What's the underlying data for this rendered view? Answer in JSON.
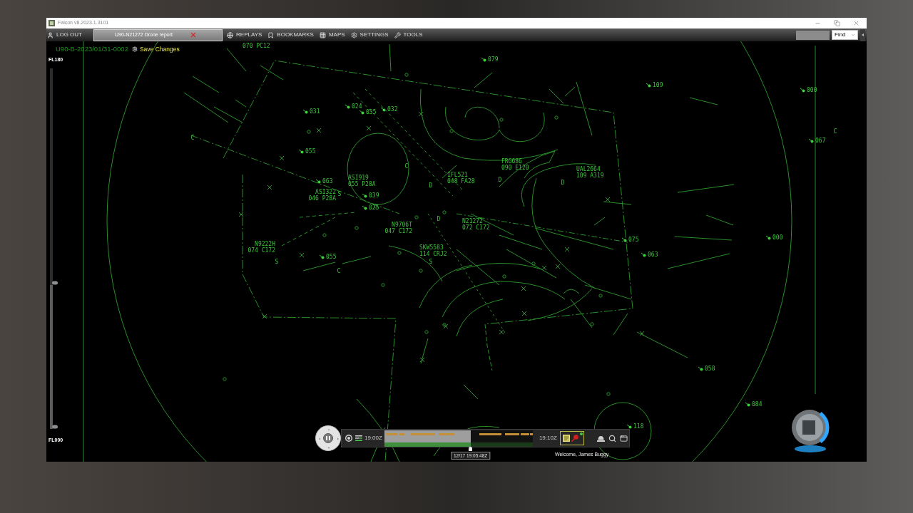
{
  "window": {
    "title": "Falcon v8.2023.1.3101"
  },
  "menu_bar": {
    "logout": "LOG OUT",
    "tabs": [
      {
        "label": "U90-N21272 Drone report",
        "selected": true
      }
    ],
    "items": [
      "REPLAYS",
      "BOOKMARKS",
      "MAPS",
      "SETTINGS",
      "TOOLS"
    ],
    "find_button": "Find"
  },
  "radar": {
    "session_id": "U90-B-2023/01/31-0002",
    "save_button": "Save Changes",
    "altitude_filter": {
      "top_label": "FL180",
      "bottom_label": "FL000",
      "thumbs": [
        {
          "level": 0.4
        },
        {
          "level": 0
        }
      ]
    },
    "targets": [
      {
        "kind": "full",
        "data": "070 PC12"
      },
      {
        "kind": "limited",
        "data": "079"
      },
      {
        "kind": "limited",
        "data": "109"
      },
      {
        "kind": "limited",
        "data": "000"
      },
      {
        "kind": "limited",
        "data": "031"
      },
      {
        "kind": "limited",
        "data": "024"
      },
      {
        "kind": "limited",
        "data": "035"
      },
      {
        "kind": "limited",
        "data": "032"
      },
      {
        "kind": "limited",
        "data": "067"
      },
      {
        "kind": "limited",
        "data": "055"
      },
      {
        "kind": "full",
        "callsign": "FRG686",
        "data": "090 E120"
      },
      {
        "kind": "limited",
        "data": "063"
      },
      {
        "kind": "full",
        "callsign": "ASI919",
        "data": "055 P28A"
      },
      {
        "kind": "full",
        "callsign": "IFL521",
        "data": "048 FA28"
      },
      {
        "kind": "full",
        "callsign": "UAL2664",
        "data": "109 A319"
      },
      {
        "kind": "full",
        "callsign": "ASI322",
        "data": "046 P28A"
      },
      {
        "kind": "limited",
        "data": "039"
      },
      {
        "kind": "limited",
        "data": "025"
      },
      {
        "kind": "full",
        "callsign": "N9706T",
        "data": "047 C172"
      },
      {
        "kind": "full",
        "callsign": "N21272",
        "data": "072 C172"
      },
      {
        "kind": "limited",
        "data": "075"
      },
      {
        "kind": "limited",
        "data": "000"
      },
      {
        "kind": "full",
        "callsign": "N9222H",
        "data": "074 C172"
      },
      {
        "kind": "limited",
        "data": "055"
      },
      {
        "kind": "full",
        "callsign": "SKW5583",
        "data": "114 CRJ2"
      },
      {
        "kind": "limited",
        "data": "063"
      },
      {
        "kind": "limited",
        "data": "058"
      },
      {
        "kind": "limited",
        "data": "084"
      },
      {
        "kind": "limited",
        "data": "118"
      }
    ],
    "position_symbols": [
      "C",
      "C",
      "C",
      "D",
      "D",
      "D",
      "S",
      "D",
      "S",
      "S",
      "C"
    ]
  },
  "playback": {
    "playing": true,
    "start_time": "19:00Z",
    "timeline": {
      "level": 0.58
    },
    "cursor_time": "12/17 19:05:48Z",
    "end_time": "19:10Z",
    "welcome": "Welcome, James Buggy"
  }
}
